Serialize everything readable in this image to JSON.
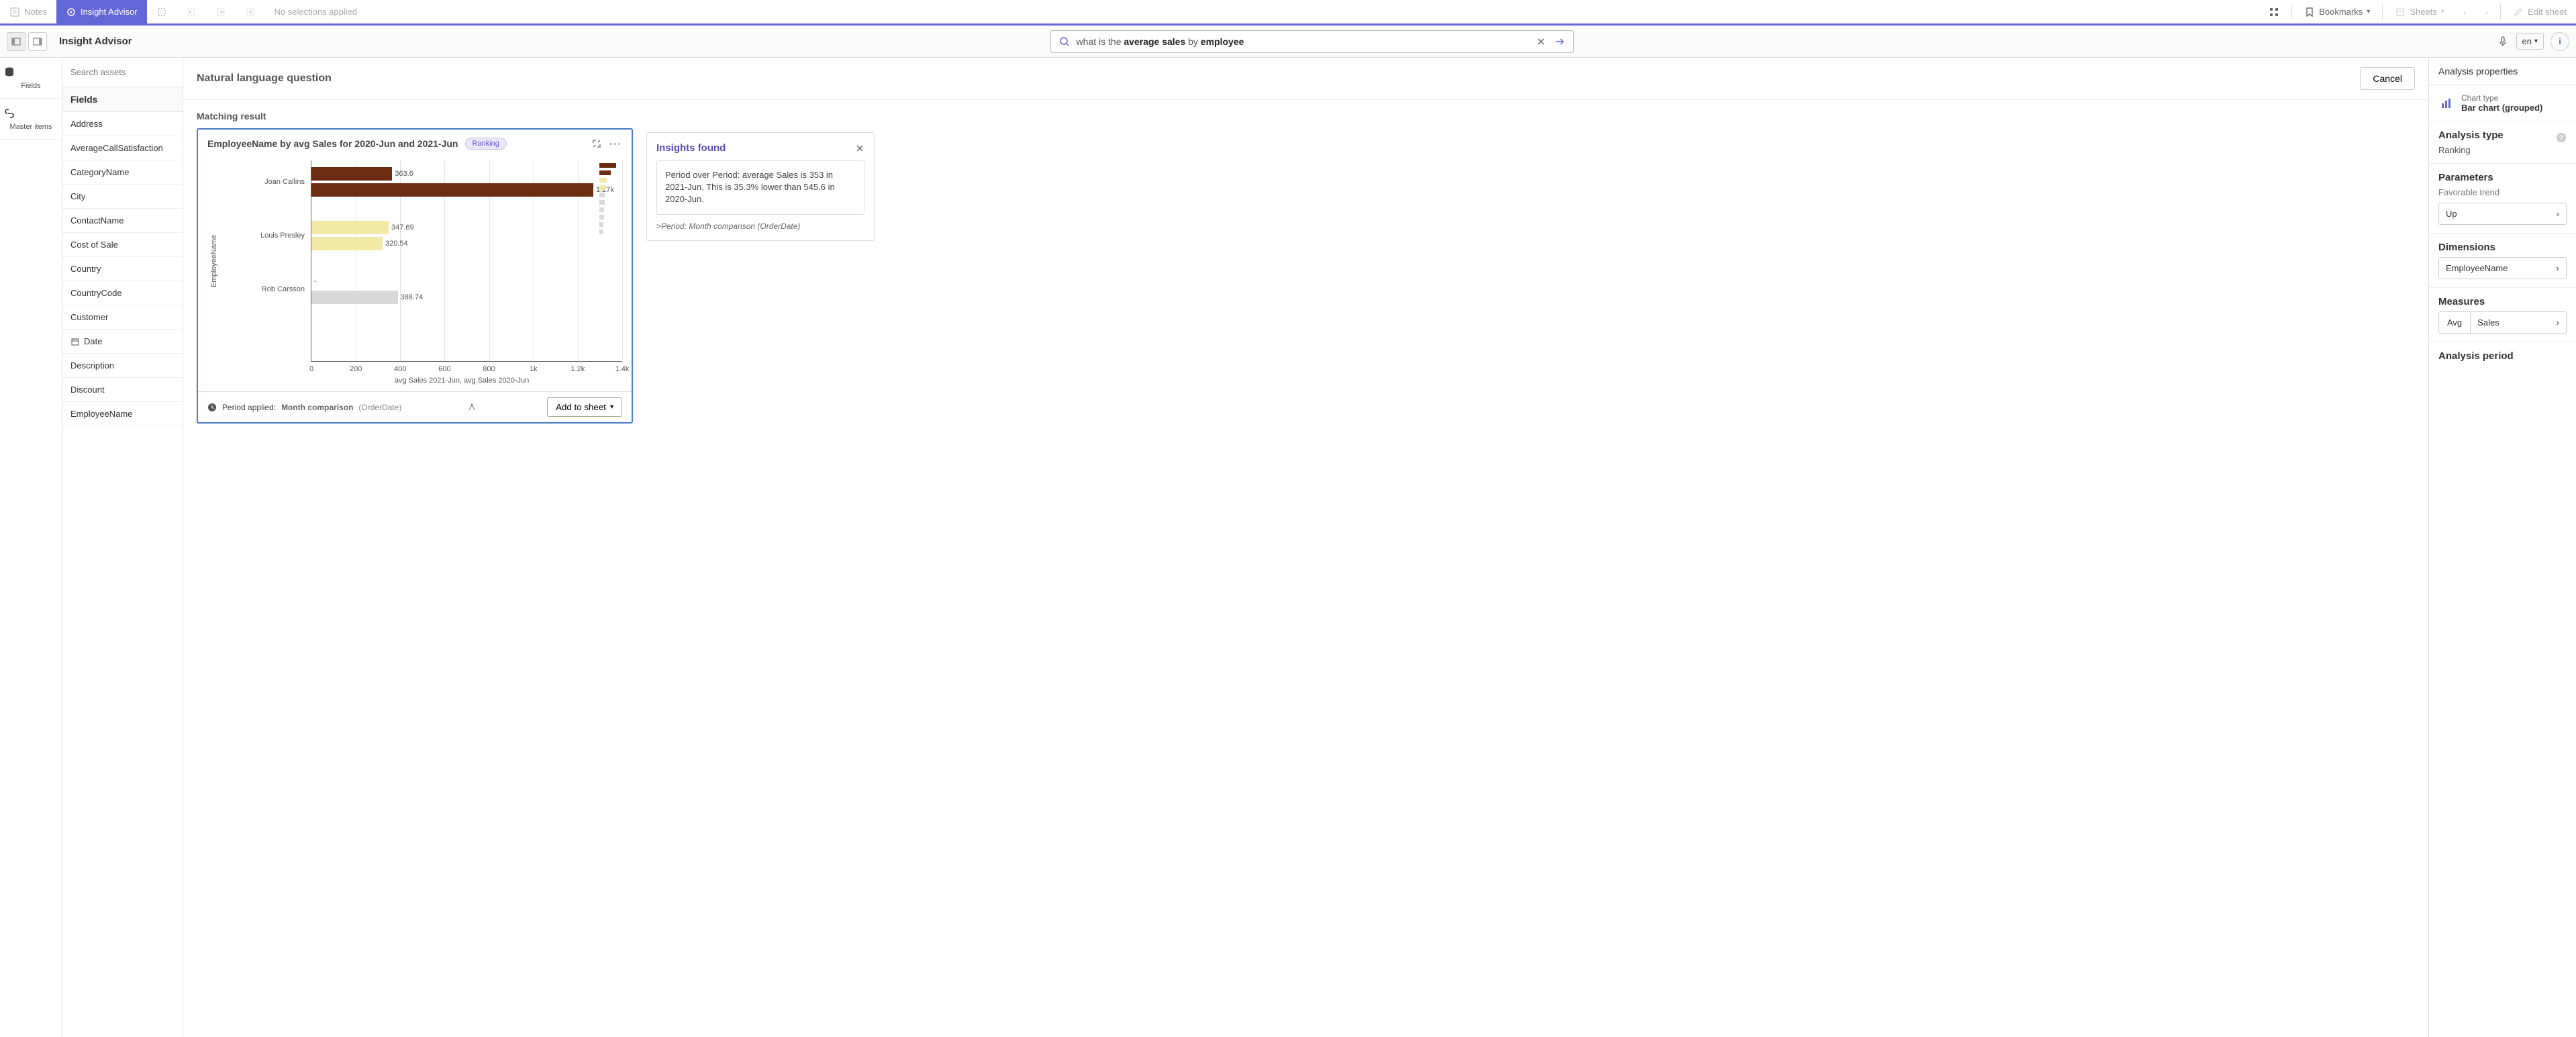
{
  "toolbar": {
    "notes": "Notes",
    "insight_advisor": "Insight Advisor",
    "no_selections": "No selections applied",
    "bookmarks": "Bookmarks",
    "sheets": "Sheets",
    "edit_sheet": "Edit sheet"
  },
  "sub": {
    "page_title": "Insight Advisor",
    "search_prefix": "what is the ",
    "search_bold1": "average sales",
    "search_mid": " by ",
    "search_bold2": "employee",
    "lang": "en"
  },
  "rail": {
    "fields": "Fields",
    "master": "Master items"
  },
  "fields": {
    "search_placeholder": "Search assets",
    "header": "Fields",
    "items": [
      "Address",
      "AverageCallSatisfaction",
      "CategoryName",
      "City",
      "ContactName",
      "Cost of Sale",
      "Country",
      "CountryCode",
      "Customer",
      "Date",
      "Description",
      "Discount",
      "EmployeeName"
    ]
  },
  "center": {
    "nlq_title": "Natural language question",
    "cancel": "Cancel",
    "matching": "Matching result",
    "chart_title": "EmployeeName by avg Sales for 2020-Jun and 2021-Jun",
    "rank_pill": "Ranking",
    "period_applied_label": "Period applied:",
    "period_applied_name": "Month comparison",
    "period_applied_suffix": "(OrderDate)",
    "add_to_sheet": "Add to sheet"
  },
  "insights": {
    "title": "Insights found",
    "body": "Period over Period: average Sales is 353 in 2021-Jun. This is 35.3% lower than 545.6 in 2020-Jun.",
    "note_prefix": ">",
    "note": "Period: Month comparison (OrderDate)"
  },
  "props": {
    "header": "Analysis properties",
    "chart_type_label": "Chart type",
    "chart_type_value": "Bar chart (grouped)",
    "analysis_type_label": "Analysis type",
    "analysis_type_value": "Ranking",
    "parameters_label": "Parameters",
    "fav_trend_label": "Favorable trend",
    "fav_trend_value": "Up",
    "dimensions_label": "Dimensions",
    "dimension_value": "EmployeeName",
    "measures_label": "Measures",
    "measure_agg": "Avg",
    "measure_field": "Sales",
    "analysis_period_label": "Analysis period"
  },
  "chart_data": {
    "type": "bar",
    "orientation": "horizontal",
    "grouped": true,
    "ylabel": "EmployeeName",
    "xlabel": "avg Sales 2021-Jun, avg Sales 2020-Jun",
    "xlim": [
      0,
      1400
    ],
    "xticks": [
      0,
      200,
      400,
      600,
      800,
      "1k",
      "1.2k",
      "1.4k"
    ],
    "categories": [
      "Joan Callins",
      "Louis Presley",
      "Rob Carsson"
    ],
    "series": [
      {
        "name": "avg Sales 2021-Jun",
        "color": "#6b2c11",
        "values": [
          363.6,
          347.69,
          null
        ],
        "labels": [
          "363.6",
          "347.69",
          "-"
        ]
      },
      {
        "name": "avg Sales 2020-Jun",
        "color_map": [
          "#6b2c11",
          "#f3e9a6",
          "#d9d9d9"
        ],
        "values": [
          1270,
          320.54,
          388.74
        ],
        "labels": [
          "1.27k",
          "320.54",
          "388.74"
        ]
      }
    ]
  }
}
